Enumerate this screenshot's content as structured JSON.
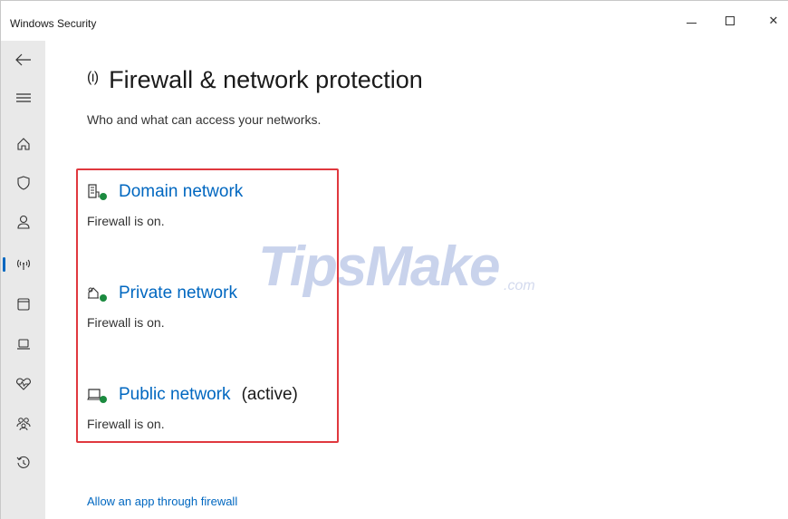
{
  "window": {
    "title": "Windows Security"
  },
  "titlebar_buttons": {
    "minimize_icon": "minimize-icon",
    "maximize_icon": "maximize-icon",
    "close_icon": "close-icon",
    "close_glyph": "✕"
  },
  "rail": {
    "items": [
      {
        "icon": "back-arrow-icon"
      },
      {
        "icon": "hamburger-menu-icon"
      },
      {
        "icon": "home-icon"
      },
      {
        "icon": "shield-icon"
      },
      {
        "icon": "account-icon"
      },
      {
        "icon": "wireless-icon",
        "active": true
      },
      {
        "icon": "app-browser-icon"
      },
      {
        "icon": "laptop-icon"
      },
      {
        "icon": "heart-pulse-icon"
      },
      {
        "icon": "family-icon"
      },
      {
        "icon": "history-icon"
      }
    ],
    "accent_color": "#0067c0"
  },
  "main": {
    "title_icon": "(ı)",
    "title": "Firewall & network protection",
    "subtitle": "Who and what can access your networks.",
    "networks": [
      {
        "name": "Domain network",
        "status": "Firewall is on.",
        "active_label": "",
        "icon": "domain-network-icon"
      },
      {
        "name": "Private network",
        "status": "Firewall is on.",
        "active_label": "",
        "icon": "private-network-icon"
      },
      {
        "name": "Public network",
        "status": "Firewall is on.",
        "active_label": "(active)",
        "icon": "public-network-icon"
      }
    ],
    "allow_app_link": "Allow an app through firewall"
  },
  "watermark": {
    "text": "TipsMake",
    "suffix": ".com"
  },
  "colors": {
    "link": "#0067c0",
    "highlight_border": "#e0383e",
    "status_ok": "#1b8a3f",
    "rail_background": "#e9e9e9"
  }
}
